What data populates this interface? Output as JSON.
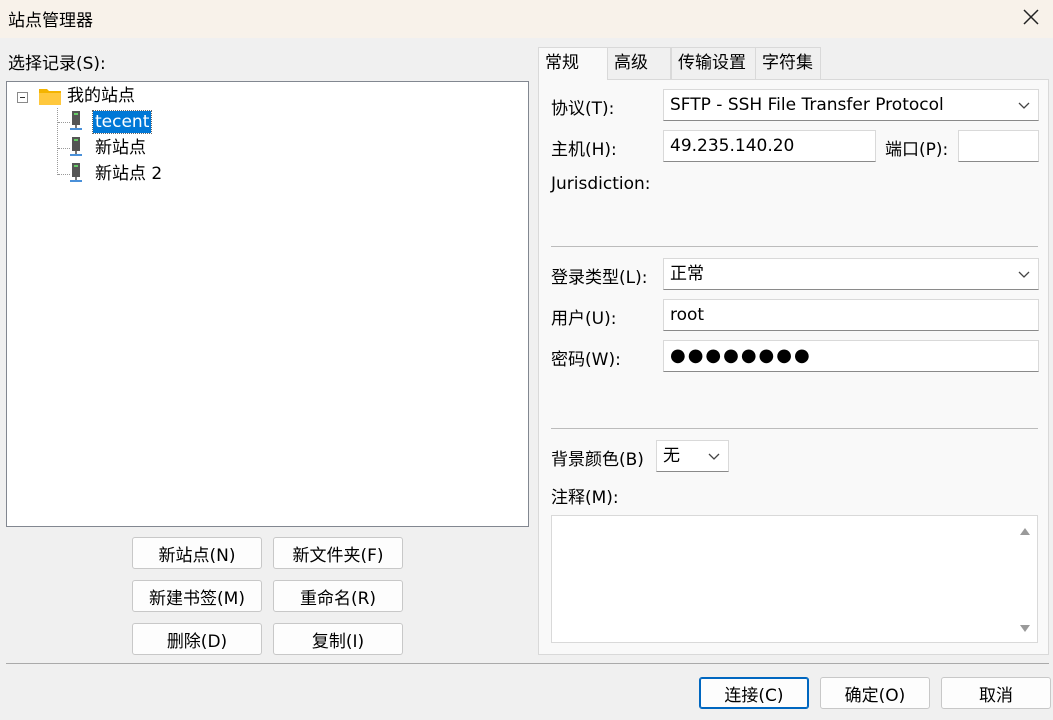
{
  "window": {
    "title": "站点管理器",
    "close_icon": "close-icon"
  },
  "left": {
    "label": "选择记录(S):",
    "tree": {
      "root": "我的站点",
      "children": [
        "tecent",
        "新站点",
        "新站点 2"
      ],
      "selected": "tecent"
    },
    "buttons": {
      "new_site": "新站点(N)",
      "new_folder": "新文件夹(F)",
      "new_bookmark": "新建书签(M)",
      "rename": "重命名(R)",
      "delete": "删除(D)",
      "copy": "复制(I)"
    }
  },
  "tabs": [
    "常规",
    "高级",
    "传输设置",
    "字符集"
  ],
  "active_tab": "常规",
  "general": {
    "protocol_label": "协议(T):",
    "protocol_value": "SFTP - SSH File Transfer Protocol",
    "host_label": "主机(H):",
    "host_value": "49.235.140.20",
    "port_label": "端口(P):",
    "port_value": "",
    "jurisdiction_label": "Jurisdiction:",
    "logon_type_label": "登录类型(L):",
    "logon_type_value": "正常",
    "user_label": "用户(U):",
    "user_value": "root",
    "password_label": "密码(W):",
    "password_value": "●●●●●●●●",
    "bg_color_label": "背景颜色(B)",
    "bg_color_value": "无",
    "comments_label": "注释(M):",
    "comments_value": ""
  },
  "footer": {
    "connect": "连接(C)",
    "ok": "确定(O)",
    "cancel": "取消"
  },
  "colors": {
    "selection": "#0078d7",
    "folder": "#f4b400",
    "primary_border": "#0067c0"
  }
}
